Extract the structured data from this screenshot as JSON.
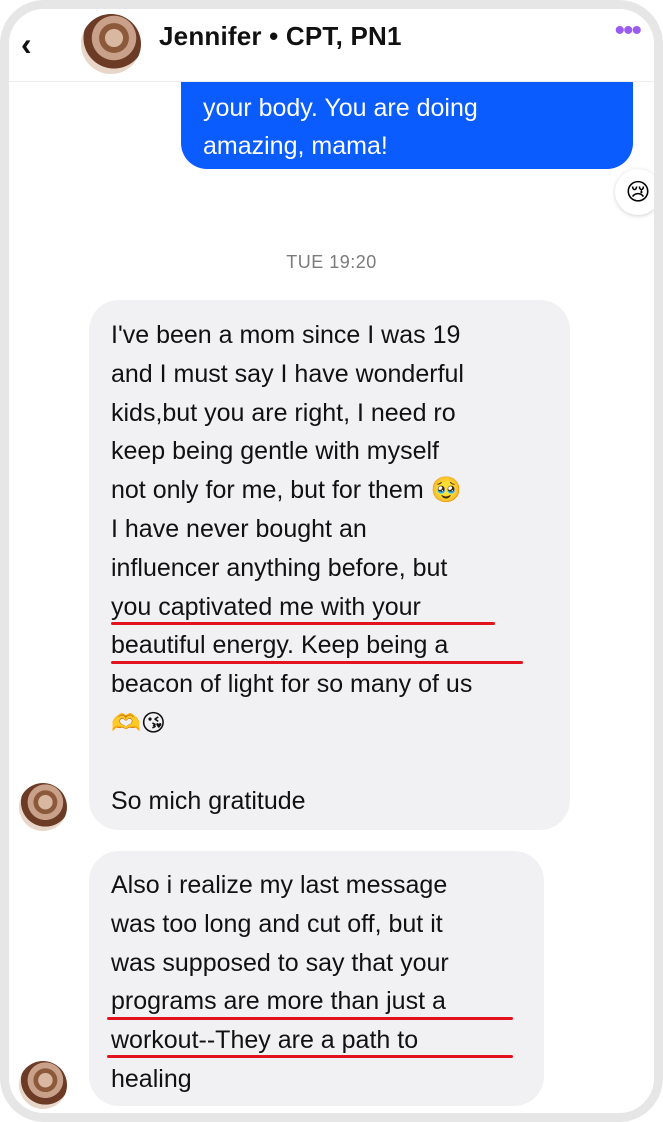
{
  "header": {
    "back_icon": "chevron-left-icon",
    "contact_name": "Jennifer • CPT, PN1",
    "menu_icon": "more-dots-icon"
  },
  "sent_message": {
    "lines": [
      "your body. You are doing",
      "amazing, mama!"
    ],
    "reaction": "😢"
  },
  "timestamp": "TUE 19:20",
  "received_messages": [
    {
      "lines": [
        "I've been a mom since I was 19",
        "and I must say I have wonderful",
        "kids,but you are right, I need ro",
        "keep being gentle with myself",
        "not only for me, but for them 🥹",
        "I have never bought an",
        "influencer anything before, but",
        "you captivated me with your",
        "beautiful energy. Keep being a",
        "beacon of light for so many of us",
        "🫶😘",
        "",
        "So mich gratitude"
      ],
      "underlined_lines": [
        7,
        8
      ]
    },
    {
      "lines": [
        "Also i realize my last message",
        "was too long and cut off, but it",
        "was supposed to say that your",
        "programs are more than just a",
        "workout--They are a path to",
        "healing"
      ],
      "underlined_lines": [
        3,
        4
      ]
    }
  ],
  "colors": {
    "sent_bubble": "#0a5cff",
    "received_bubble": "#f1f1f4",
    "underline": "#e2131c",
    "menu_accent": "#9a5cf0"
  }
}
